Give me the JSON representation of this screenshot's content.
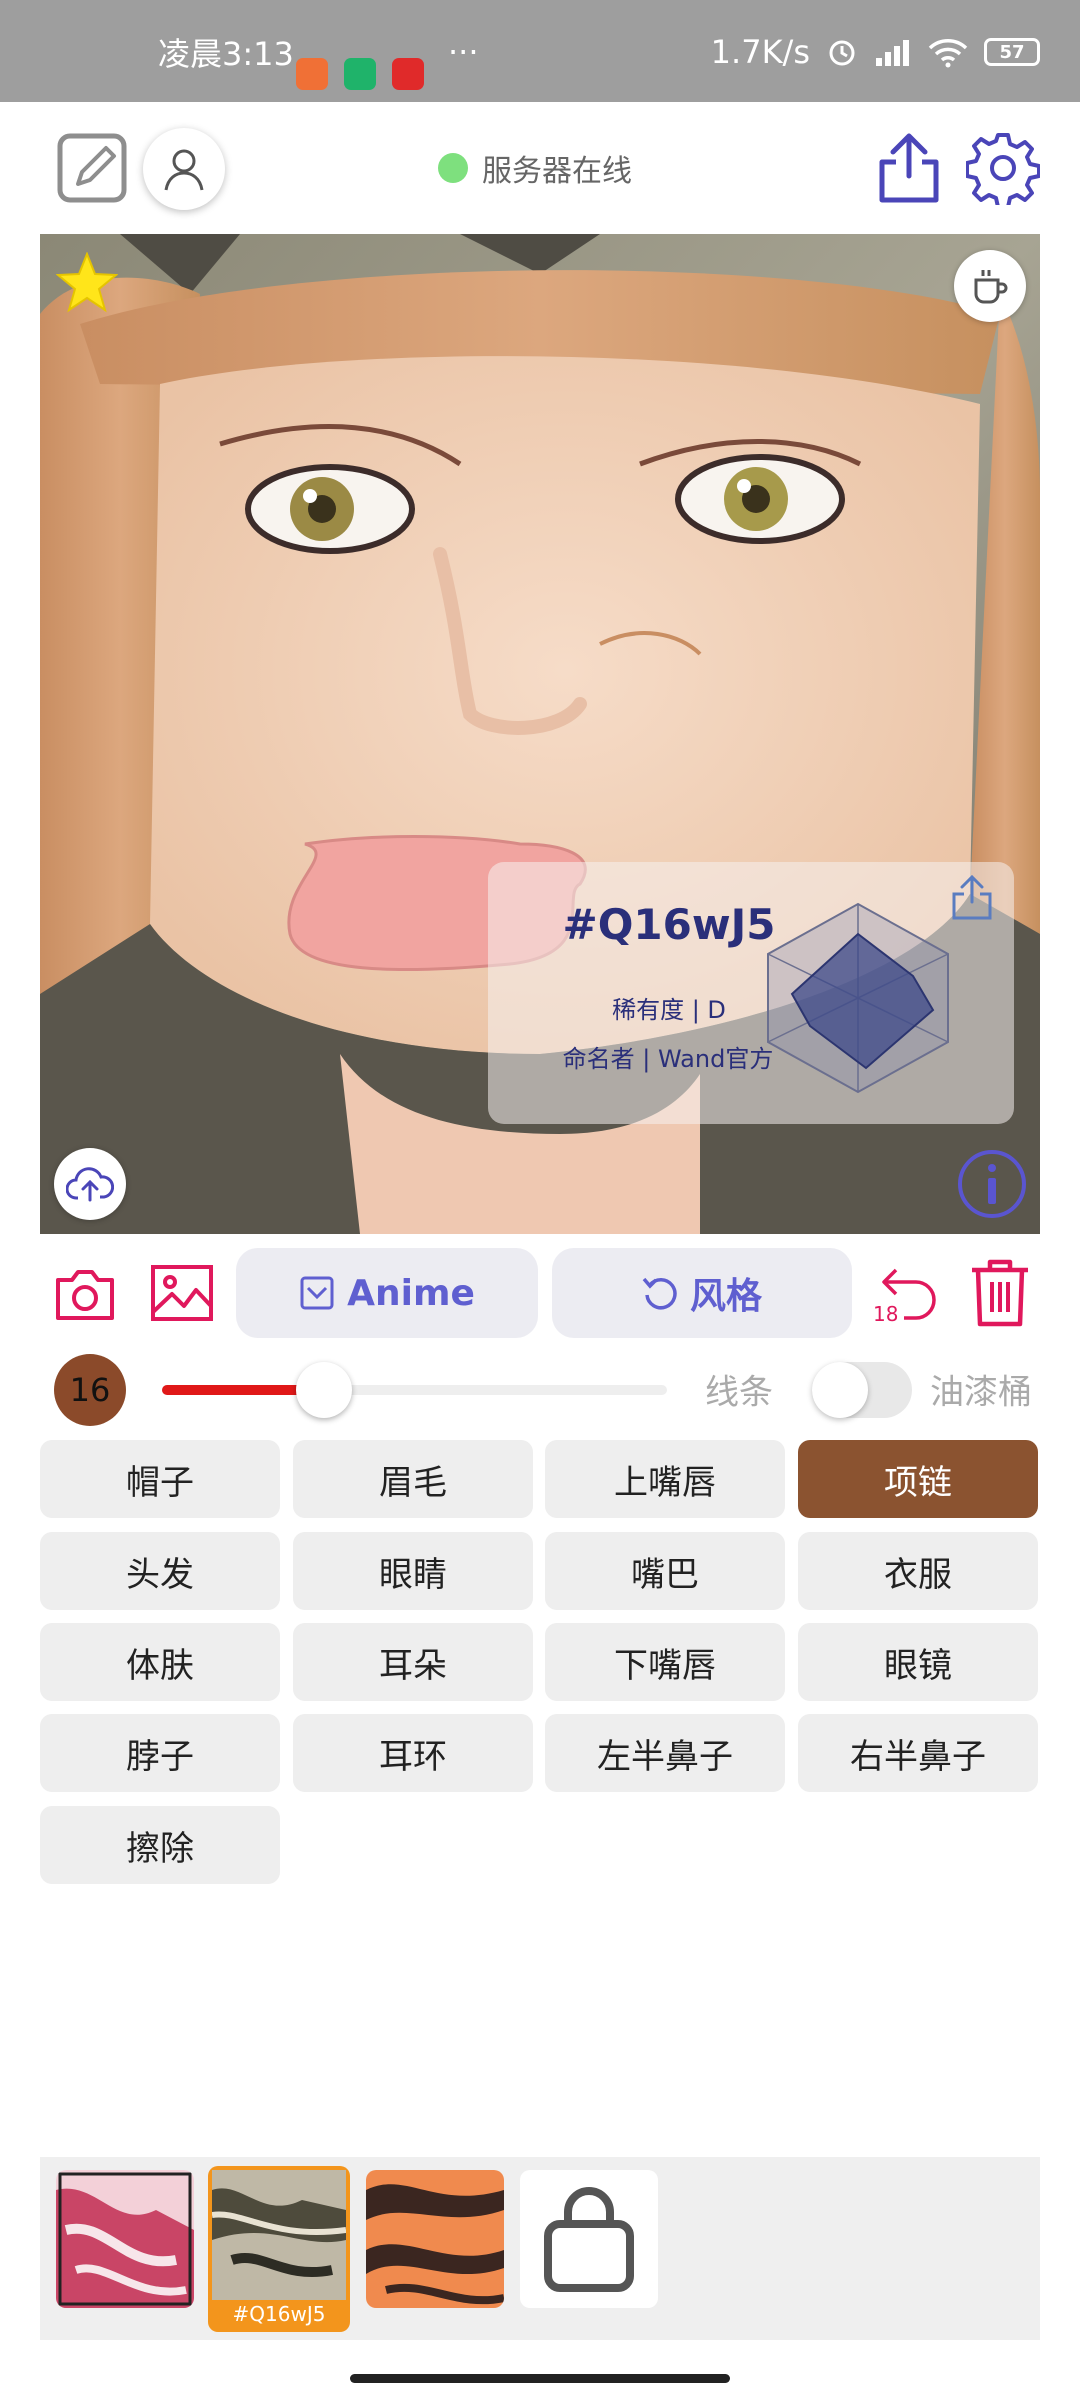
{
  "status_bar": {
    "time": "凌晨3:13",
    "dots": "···",
    "net_speed": "1.7K/s",
    "battery": "57"
  },
  "header": {
    "server_status": "服务器在线",
    "server_status_color": "#7ee07e"
  },
  "result_card": {
    "id": "#Q16wJ5",
    "rarity": "稀有度 | D",
    "namer": "命名者 | Wand官方"
  },
  "toolbar": {
    "anime_label": "Anime",
    "style_label": "风格",
    "undo_count": "18",
    "accent_color": "#e0185c"
  },
  "brush": {
    "size": "16",
    "slider_progress": 0.32,
    "mode_line": "线条",
    "mode_bucket": "油漆桶",
    "bucket_enabled": false
  },
  "parts": [
    {
      "label": "帽子",
      "selected": false
    },
    {
      "label": "眉毛",
      "selected": false
    },
    {
      "label": "上嘴唇",
      "selected": false
    },
    {
      "label": "项链",
      "selected": true
    },
    {
      "label": "头发",
      "selected": false
    },
    {
      "label": "眼睛",
      "selected": false
    },
    {
      "label": "嘴巴",
      "selected": false
    },
    {
      "label": "衣服",
      "selected": false
    },
    {
      "label": "体肤",
      "selected": false
    },
    {
      "label": "耳朵",
      "selected": false
    },
    {
      "label": "下嘴唇",
      "selected": false
    },
    {
      "label": "眼镜",
      "selected": false
    },
    {
      "label": "脖子",
      "selected": false
    },
    {
      "label": "耳环",
      "selected": false
    },
    {
      "label": "左半鼻子",
      "selected": false
    },
    {
      "label": "右半鼻子",
      "selected": false
    },
    {
      "label": "擦除",
      "selected": false
    }
  ],
  "gallery": {
    "selected_label": "#Q16wJ5"
  }
}
